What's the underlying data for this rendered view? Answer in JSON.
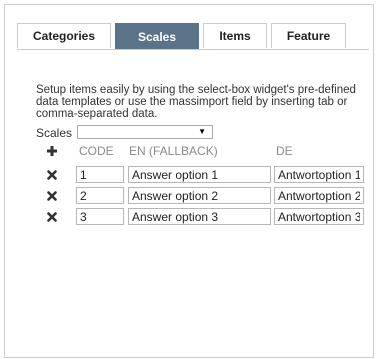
{
  "tabs": [
    {
      "label": "Categories",
      "active": false
    },
    {
      "label": "Scales",
      "active": true
    },
    {
      "label": "Items",
      "active": false
    },
    {
      "label": "Feature",
      "active": false
    }
  ],
  "help_text": "Setup items easily by using the select-box widget's pre-defined data templates or use the massimport field by inserting tab or comma-separated data.",
  "scales": {
    "label": "Scales",
    "selected": ""
  },
  "columns": {
    "code": "CODE",
    "en": "EN (FALLBACK)",
    "de": "DE"
  },
  "rows": [
    {
      "code": "1",
      "en": "Answer option 1",
      "de": "Antwortoption 1"
    },
    {
      "code": "2",
      "en": "Answer option 2",
      "de": "Antwortoption 2"
    },
    {
      "code": "3",
      "en": "Answer option 3",
      "de": "Antwortoption 3"
    }
  ],
  "icons": {
    "add": "plus-icon",
    "delete": "times-icon"
  },
  "colors": {
    "active_tab": "#5b7388",
    "header_text": "#8a8a8a"
  }
}
